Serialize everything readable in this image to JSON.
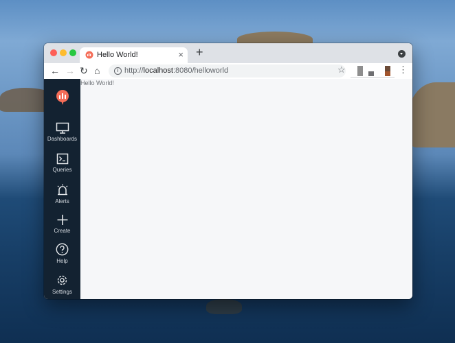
{
  "browser": {
    "tab": {
      "title": "Hello World!",
      "close_icon": "×"
    },
    "new_tab_icon": "+",
    "nav": {
      "back_icon": "←",
      "forward_icon": "→",
      "reload_icon": "↻",
      "home_icon": "⌂"
    },
    "url": {
      "scheme": "http://",
      "host": "localhost",
      "rest": ":8080/helloworld"
    },
    "star_icon": "☆",
    "menu_icon": "⋮"
  },
  "sidebar": {
    "items": [
      {
        "label": "Dashboards",
        "icon": "monitor-icon"
      },
      {
        "label": "Queries",
        "icon": "terminal-icon"
      },
      {
        "label": "Alerts",
        "icon": "siren-icon"
      },
      {
        "label": "Create",
        "icon": "plus-icon"
      },
      {
        "label": "Help",
        "icon": "help-icon"
      },
      {
        "label": "Settings",
        "icon": "gear-icon"
      }
    ]
  },
  "main": {
    "text": "Hello World!"
  },
  "colors": {
    "sidebar_bg": "#132231",
    "brand": "#f56d58",
    "content_bg": "#f6f7f9"
  }
}
